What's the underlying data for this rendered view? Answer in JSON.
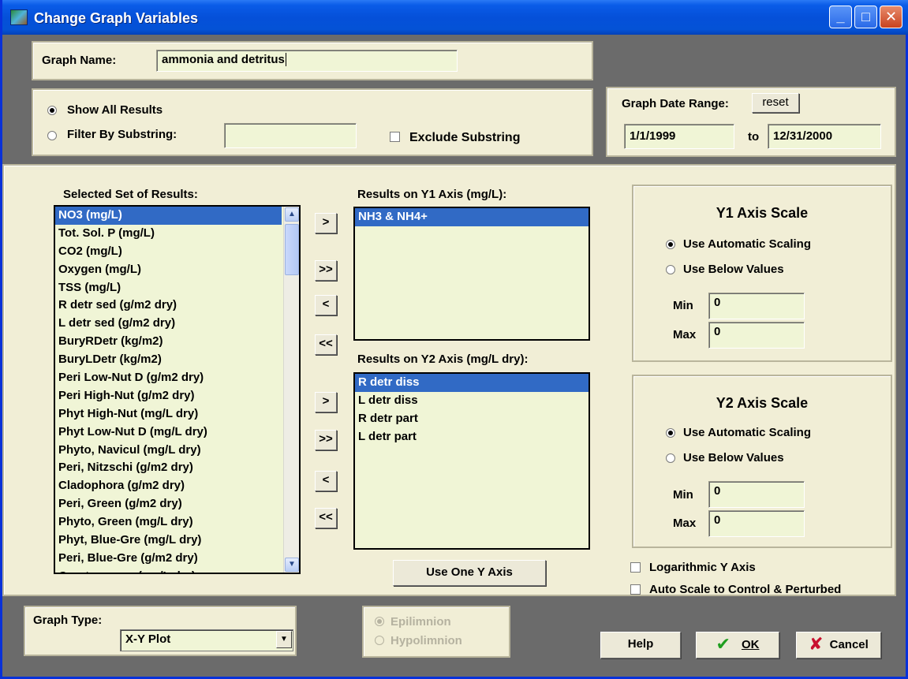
{
  "window": {
    "title": "Change Graph Variables",
    "minimize": "_",
    "maximize": "□",
    "close": "✕"
  },
  "graph_name": {
    "label": "Graph Name:",
    "value": "ammonia and detritus"
  },
  "filter": {
    "show_all_label": "Show All Results",
    "filter_label": "Filter By Substring:",
    "filter_value": "",
    "exclude_label": "Exclude Substring",
    "selected": "show_all"
  },
  "date_range": {
    "label": "Graph Date Range:",
    "reset": "reset",
    "start": "1/1/1999",
    "to": "to",
    "end": "12/31/2000"
  },
  "selected_set": {
    "label": "Selected Set of Results:",
    "items": [
      "NO3 (mg/L)",
      "Tot. Sol. P (mg/L)",
      "CO2 (mg/L)",
      "Oxygen (mg/L)",
      "TSS (mg/L)",
      "R detr sed (g/m2 dry)",
      "L detr sed (g/m2 dry)",
      "BuryRDetr (kg/m2)",
      "BuryLDetr (kg/m2)",
      "Peri Low-Nut D (g/m2 dry)",
      "Peri High-Nut  (g/m2 dry)",
      "Phyt High-Nut  (mg/L dry)",
      "Phyt Low-Nut D (mg/L dry)",
      "Phyto, Navicul (mg/L dry)",
      "Peri, Nitzschi (g/m2 dry)",
      "Cladophora (g/m2 dry)",
      "Peri, Green (g/m2 dry)",
      "Phyto, Green (mg/L dry)",
      "Phyt, Blue-Gre (mg/L dry)",
      "Peri, Blue-Gre (g/m2 dry)",
      "Cryptomonas (mg/L dry)"
    ],
    "selected_index": 0
  },
  "arrows": {
    "add": ">",
    "add_all": ">>",
    "remove": "<",
    "remove_all": "<<"
  },
  "y1_results": {
    "label": "Results on Y1 Axis  (mg/L):",
    "items": [
      "NH3 & NH4+"
    ]
  },
  "y2_results": {
    "label": "Results on Y2 Axis  (mg/L dry):",
    "items": [
      "R detr diss",
      "L detr diss",
      "R detr part",
      "L detr part"
    ]
  },
  "use_one_axis": "Use One Y Axis",
  "y1_scale": {
    "title": "Y1 Axis Scale",
    "auto_label": "Use Automatic Scaling",
    "below_label": "Use Below Values",
    "min_label": "Min",
    "min": "0",
    "max_label": "Max",
    "max": "0",
    "selected": "auto"
  },
  "y2_scale": {
    "title": "Y2 Axis Scale",
    "auto_label": "Use Automatic Scaling",
    "below_label": "Use Below Values",
    "min_label": "Min",
    "min": "0",
    "max_label": "Max",
    "max": "0",
    "selected": "auto"
  },
  "options": {
    "log_label": "Logarithmic Y Axis",
    "log_checked": false,
    "autoscale_label": "Auto Scale to Control & Perturbed",
    "autoscale_checked": false
  },
  "graph_type": {
    "label": "Graph Type:",
    "value": "X-Y Plot"
  },
  "layer": {
    "epi": "Epilimnion",
    "hypo": "Hypolimnion",
    "selected": "epi",
    "enabled": false
  },
  "buttons": {
    "help": "Help",
    "ok": "OK",
    "cancel": "Cancel"
  },
  "colors": {
    "title_bar": "#0550d9",
    "panel": "#f1eed6",
    "field": "#f0f5d6",
    "selection": "#316ac5",
    "ok_check": "#1f9e1f",
    "cancel_x": "#c8102e"
  }
}
